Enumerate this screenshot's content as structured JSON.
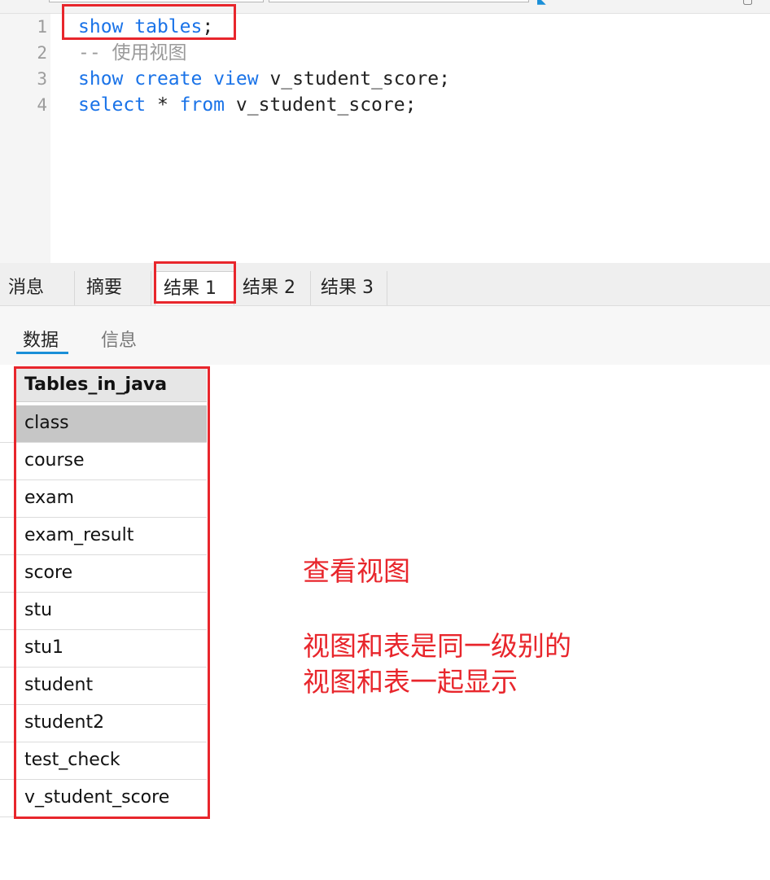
{
  "editor": {
    "lines": [
      {
        "no": "1",
        "tokens": [
          {
            "t": "show",
            "c": "kw"
          },
          {
            "t": " ",
            "c": "pl"
          },
          {
            "t": "tables",
            "c": "kw"
          },
          {
            "t": ";",
            "c": "pl"
          }
        ]
      },
      {
        "no": "2",
        "tokens": [
          {
            "t": "-- 使用视图",
            "c": "cm"
          }
        ]
      },
      {
        "no": "3",
        "tokens": [
          {
            "t": "show",
            "c": "kw"
          },
          {
            "t": " ",
            "c": "pl"
          },
          {
            "t": "create",
            "c": "kw"
          },
          {
            "t": " ",
            "c": "pl"
          },
          {
            "t": "view",
            "c": "kw"
          },
          {
            "t": " v_student_score;",
            "c": "pl"
          }
        ]
      },
      {
        "no": "4",
        "tokens": [
          {
            "t": "select",
            "c": "kw"
          },
          {
            "t": " * ",
            "c": "pl"
          },
          {
            "t": "from",
            "c": "kw"
          },
          {
            "t": " v_student_score;",
            "c": "pl"
          }
        ]
      }
    ]
  },
  "result_tabs": [
    "消息",
    "摘要",
    "结果 1",
    "结果 2",
    "结果 3"
  ],
  "active_result_tab": "结果 1",
  "sub_tabs": [
    "数据",
    "信息"
  ],
  "active_sub_tab": "数据",
  "grid": {
    "column": "Tables_in_java",
    "rows": [
      "class",
      "course",
      "exam",
      "exam_result",
      "score",
      "stu",
      "stu1",
      "student",
      "student2",
      "test_check",
      "v_student_score"
    ],
    "selected_row": "class"
  },
  "annotations": {
    "note1": "查看视图",
    "note2": "视图和表是同一级别的",
    "note3": "视图和表一起显示"
  },
  "colors": {
    "keyword": "#1a73e8",
    "comment": "#9a9a9a",
    "annotation": "#e8262c",
    "tab_underline": "#1a8fd8"
  }
}
